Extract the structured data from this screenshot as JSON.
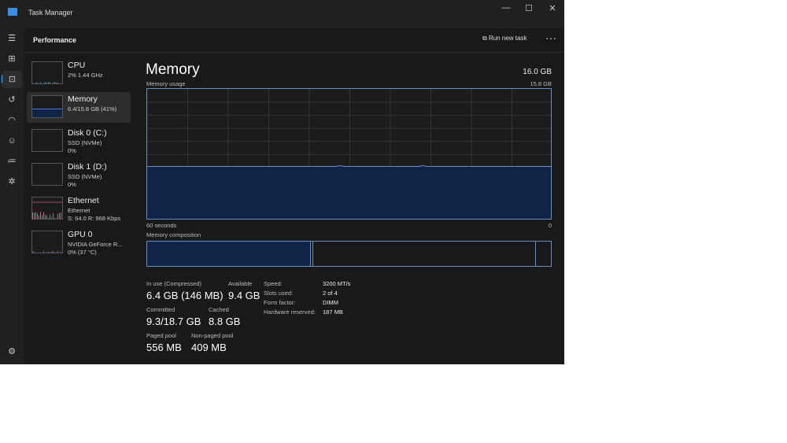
{
  "window": {
    "title": "Task Manager",
    "minimize": "—",
    "maximize": "☐",
    "close": "✕"
  },
  "header": {
    "section": "Performance",
    "run_new_task": "Run new task",
    "more": "···"
  },
  "rail": [
    "menu-icon",
    "processes-icon",
    "performance-icon",
    "app-history-icon",
    "startup-apps-icon",
    "users-icon",
    "details-icon",
    "services-icon",
    "settings-icon"
  ],
  "devices": [
    {
      "name": "CPU",
      "sub1": "2% 1.44 GHz",
      "sub2": "",
      "color": "#4a9ad8"
    },
    {
      "name": "Memory",
      "sub1": "6.4/15.8 GB (41%)",
      "sub2": "",
      "color": "#4a7ad8"
    },
    {
      "name": "Disk 0 (C:)",
      "sub1": "SSD (NVMe)",
      "sub2": "0%",
      "color": "#6ab04c"
    },
    {
      "name": "Disk 1 (D:)",
      "sub1": "SSD (NVMe)",
      "sub2": "0%",
      "color": "#6ab04c"
    },
    {
      "name": "Ethernet",
      "sub1": "Ethernet",
      "sub2": "S: 64.0 R: 968 Kbps",
      "color": "#d05a80"
    },
    {
      "name": "GPU 0",
      "sub1": "NVIDIA GeForce R...",
      "sub2": "0% (37 °C)",
      "color": "#a050c8"
    }
  ],
  "main": {
    "title": "Memory",
    "total": "16.0 GB",
    "usage_label": "Memory usage",
    "usage_max": "15.8 GB",
    "x_left": "60 seconds",
    "x_right": "0",
    "usage_fraction": 0.41,
    "composition_label": "Memory composition",
    "stats": {
      "in_use_label": "In use (Compressed)",
      "in_use": "6.4 GB (146 MB)",
      "available_label": "Available",
      "available": "9.4 GB",
      "committed_label": "Committed",
      "committed": "9.3/18.7 GB",
      "cached_label": "Cached",
      "cached": "8.8 GB",
      "paged_label": "Paged pool",
      "paged": "556 MB",
      "nonpaged_label": "Non-paged pool",
      "nonpaged": "409 MB"
    },
    "specs": [
      {
        "k": "Speed:",
        "v": "3200 MT/s"
      },
      {
        "k": "Slots used:",
        "v": "2 of 4"
      },
      {
        "k": "Form factor:",
        "v": "DIMM"
      },
      {
        "k": "Hardware reserved:",
        "v": "187 MB"
      }
    ]
  },
  "colors": {
    "accent": "#4a7ad8",
    "fill": "#0f2446",
    "border": "#6a8fc0"
  }
}
